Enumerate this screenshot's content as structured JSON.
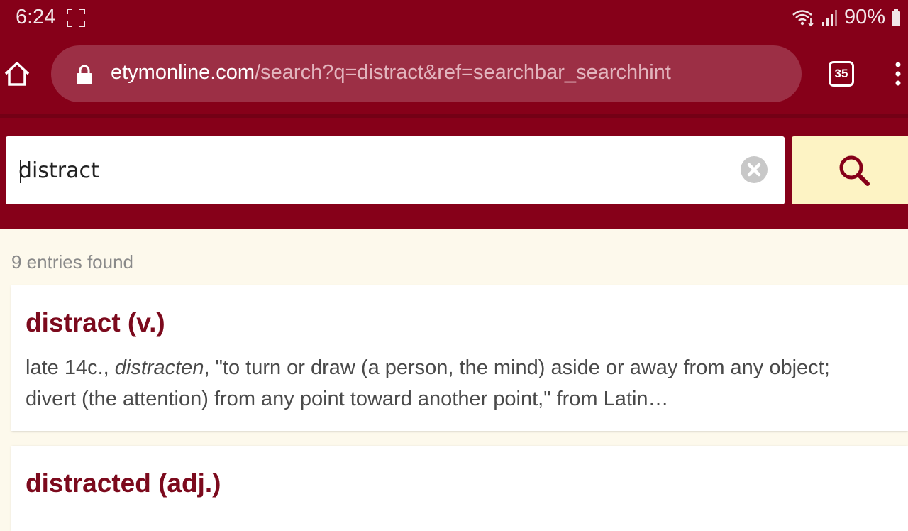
{
  "status_bar": {
    "time": "6:24",
    "battery": "90%"
  },
  "browser": {
    "url_domain": "etymonline.com",
    "url_path": "/search?q=distract&ref=searchbar_searchhint",
    "tab_count": "35"
  },
  "search": {
    "value": "distract"
  },
  "results": {
    "count_text": "9 entries found",
    "entries": [
      {
        "title": "distract (v.)",
        "snippet_prefix": "late 14c., ",
        "snippet_italic": "distracten",
        "snippet_rest": ", \"to turn or draw (a person, the mind) aside or away from any object; divert (the attention) from any point toward another point,\" from Latin…"
      },
      {
        "title": "distracted (adj.)"
      }
    ]
  },
  "colors": {
    "brand": "#860019",
    "title": "#7c0a1d",
    "search_button": "#fdf3c4"
  },
  "icons": {
    "home": "home-icon",
    "lock": "lock-icon",
    "tabs": "tabs-icon",
    "menu": "more-vertical-icon",
    "clear": "clear-icon",
    "search": "search-icon",
    "wifi": "wifi-icon",
    "signal": "signal-icon",
    "battery": "battery-icon",
    "screenshot": "screenshot-icon"
  }
}
